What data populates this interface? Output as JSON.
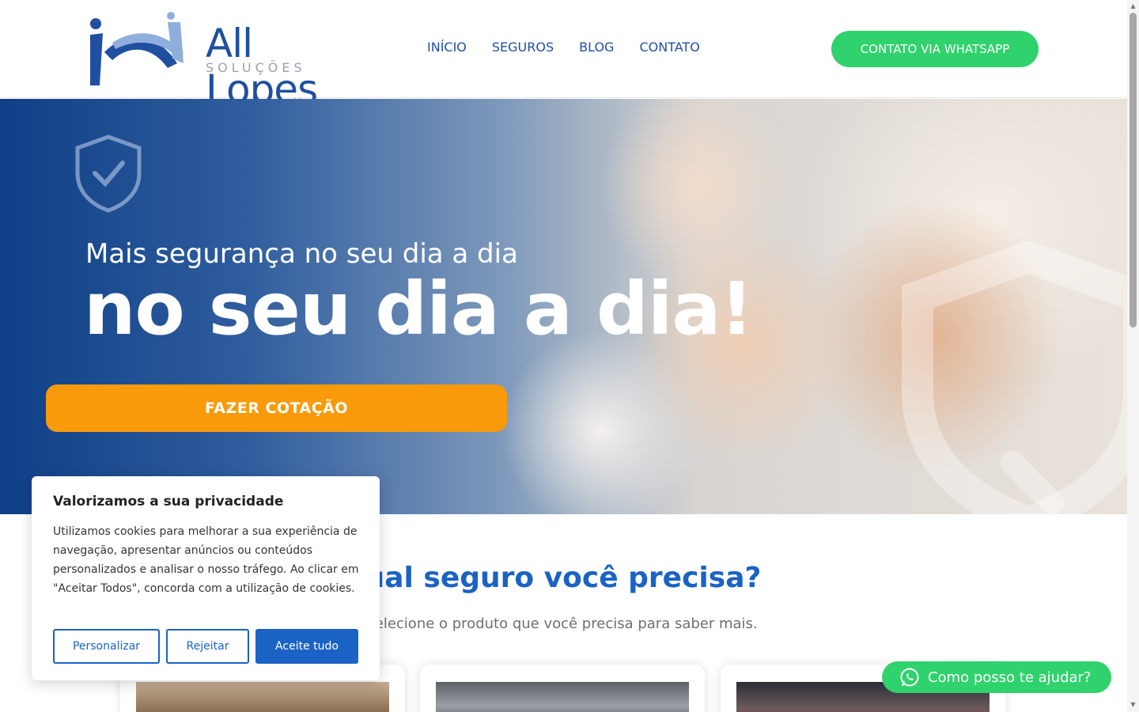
{
  "header": {
    "logo_main": "All Lopes",
    "logo_sub": "SOLUÇÕES",
    "nav": [
      "INÍCIO",
      "SEGUROS",
      "BLOG",
      "CONTATO"
    ],
    "whatsapp_button": "CONTATO VIA WHATSAPP"
  },
  "hero": {
    "subtitle": "Mais segurança no seu dia a dia",
    "title": "no seu dia a dia!",
    "cta": "FAZER COTAÇÃO"
  },
  "section": {
    "title": "Qual seguro você precisa?",
    "subtitle": "Selecione o produto que você precisa para saber mais."
  },
  "cookie": {
    "title": "Valorizamos a sua privacidade",
    "text": "Utilizamos cookies para melhorar a sua experiência de navegação, apresentar anúncios ou conteúdos personalizados e analisar o nosso tráfego. Ao clicar em \"Aceitar Todos\", concorda com a utilização de cookies.",
    "customize": "Personalizar",
    "reject": "Rejeitar",
    "accept": "Aceite tudo"
  },
  "whatsapp_float": "Como posso te ajudar?",
  "colors": {
    "brand_blue": "#1f4fa0",
    "cta_orange": "#f99a0a",
    "whatsapp_green": "#2fd26c",
    "accent_blue": "#1a63c4"
  }
}
